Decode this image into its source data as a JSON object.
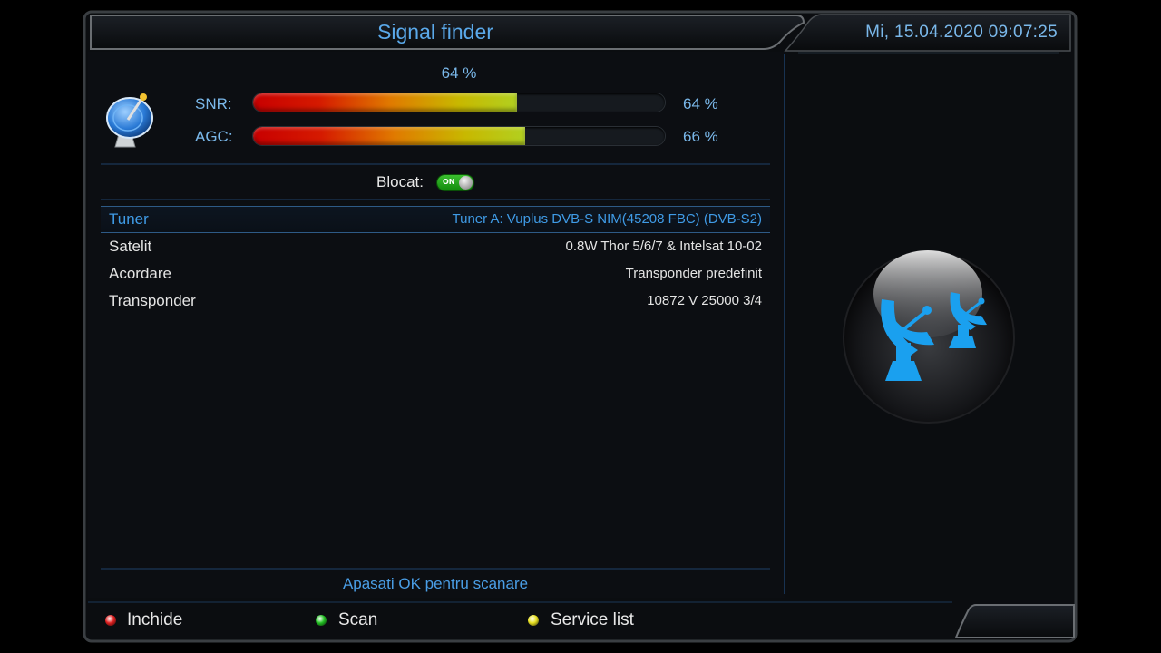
{
  "header": {
    "title": "Signal finder",
    "datetime": "Mi, 15.04.2020  09:07:25"
  },
  "signal": {
    "quality_pct": "64 %",
    "snr": {
      "label": "SNR:",
      "value": "64 %",
      "level": 0.64
    },
    "agc": {
      "label": "AGC:",
      "value": "66 %",
      "level": 0.66
    }
  },
  "lock": {
    "label": "Blocat:",
    "toggle_text": "ON"
  },
  "settings": [
    {
      "label": "Tuner",
      "value": "Tuner A: Vuplus DVB-S NIM(45208 FBC) (DVB-S2)",
      "selected": true
    },
    {
      "label": "Satelit",
      "value": "0.8W Thor 5/6/7 & Intelsat 10-02",
      "selected": false
    },
    {
      "label": "Acordare",
      "value": "Transponder predefinit",
      "selected": false
    },
    {
      "label": "Transponder",
      "value": "10872 V 25000 3/4",
      "selected": false
    }
  ],
  "hint": "Apasati OK pentru scanare",
  "buttons": {
    "red": {
      "label": "Inchide",
      "color": "#e02020"
    },
    "green": {
      "label": "Scan",
      "color": "#22c022"
    },
    "yellow": {
      "label": "Service list",
      "color": "#e8e020"
    }
  },
  "icons": {
    "signal_icon": "satellite-dish-icon",
    "preview_icon": "satellite-dishes-icon"
  },
  "colors": {
    "accent": "#5aa9ea",
    "panel": "#0c0e12"
  }
}
